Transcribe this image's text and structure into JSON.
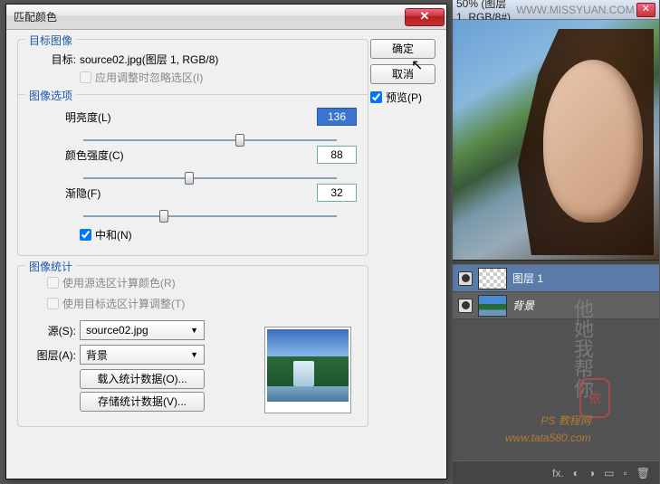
{
  "dialog": {
    "title": "匹配颜色",
    "ok": "确定",
    "cancel": "取消",
    "preview_label": "预览(P)",
    "target_group": {
      "legend": "目标图像",
      "target_label": "目标:",
      "target_value": "source02.jpg(图层 1, RGB/8)",
      "ignore_sel": "应用调整时忽略选区(I)"
    },
    "options_group": {
      "legend": "图像选项",
      "luminance_label": "明亮度(L)",
      "luminance_val": "136",
      "intensity_label": "颜色强度(C)",
      "intensity_val": "88",
      "fade_label": "渐隐(F)",
      "fade_val": "32",
      "neutralize": "中和(N)"
    },
    "stats_group": {
      "legend": "图像统计",
      "use_src_sel": "使用源选区计算颜色(R)",
      "use_tgt_sel": "使用目标选区计算调整(T)",
      "source_label": "源(S):",
      "source_val": "source02.jpg",
      "layer_label": "图层(A):",
      "layer_val": "背景",
      "load_stats": "载入统计数据(O)...",
      "save_stats": "存储统计数据(V)..."
    }
  },
  "app": {
    "doc_title": "50% (图层 1, RGB/8#)",
    "watermark_site": "WWW.MISSYUAN.COM",
    "layers": {
      "layer1": "图层 1",
      "bg": "背景"
    },
    "wm_text": "他她我帮你",
    "wm_stamp": "依",
    "wm_url1": "PS 教程网",
    "wm_url2": "www.tata580.com",
    "icons": {
      "fx": "fx.",
      "mask": "◐",
      "adj": "◑",
      "folder": "▭",
      "new": "▫",
      "trash": "🗑"
    }
  }
}
